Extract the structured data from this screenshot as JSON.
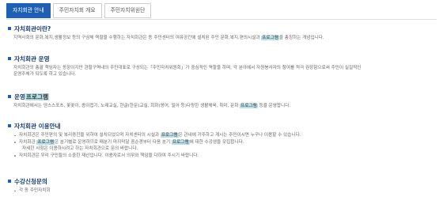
{
  "tabs": [
    {
      "label": "자치회관 안내",
      "active": true
    },
    {
      "label": "주민자치회 개요",
      "active": false
    },
    {
      "label": "주민자치위원단",
      "active": false
    }
  ],
  "sections": {
    "s1": {
      "title": "자치회관이란?",
      "text": {
        "a": "지역사회의 문화,복지,생활정보 등의 구심체 역할을 수행하는 자치회관은 동 주민센터의 여유공간에 설치된 주민 문화,복지,편의시설과 ",
        "hl": "프로그램",
        "b": "을 총칭하는 개념입니다."
      }
    },
    "s2": {
      "title": "자치회관 운영",
      "lines": [
        "자치회관의 총괄 책임자는 동장이지만 관할구역내의 주민대표로 구성되는「주민자치위원회」가 중심적인 역할을 하며, 각 분야에서 자원봉사자의 참여를 적극 권장함으로써 주민이 실질적인",
        "운영주체가 되도록 하고 있습니다."
      ]
    },
    "s3": {
      "title_a": "운영",
      "title_hl": "프로그램",
      "text": {
        "a": "자치회관에서는 댄스스포츠, 꽃꽂이, 종이접기, 노래교실, 한글(한문)교실, 회화(영어, 일어 등)다양한 생활체육, 취미, 문화 ",
        "hl": "프로그램",
        "b": " 등을 운영합니다."
      }
    },
    "s4": {
      "title": "자치회관 이용안내",
      "items": [
        {
          "a": "자치회관은 주민편의 및 복리증진을 위하여 설치되었으며 자치센터의 시설과 ",
          "hl": "프로그램",
          "b": "은 관내에 거주하고 계시는 주민이시면 누구나 이용할 수 있습니다."
        },
        {
          "a": "자치회관 ",
          "hl": "프로그램",
          "b": "은 분기별로 운영하므로 매분기 마지막달 중순경부터 다음 분기 ",
          "hl2": "프로그램",
          "c": "에 대한 수강생을 모집합니다."
        },
        {
          "cont": "자세한 사항은 이용하시려고 하는 자치회관으로 문의 바랍니다."
        },
        {
          "a": "자치회관은 우리 구민들의 소중한 재산입니다. 이용자로서 의무와 책임을 다하여 주시기 바랍니다."
        }
      ]
    },
    "s5": {
      "title": "수강신청문의",
      "items": [
        "각 동 주민자치회"
      ]
    }
  }
}
